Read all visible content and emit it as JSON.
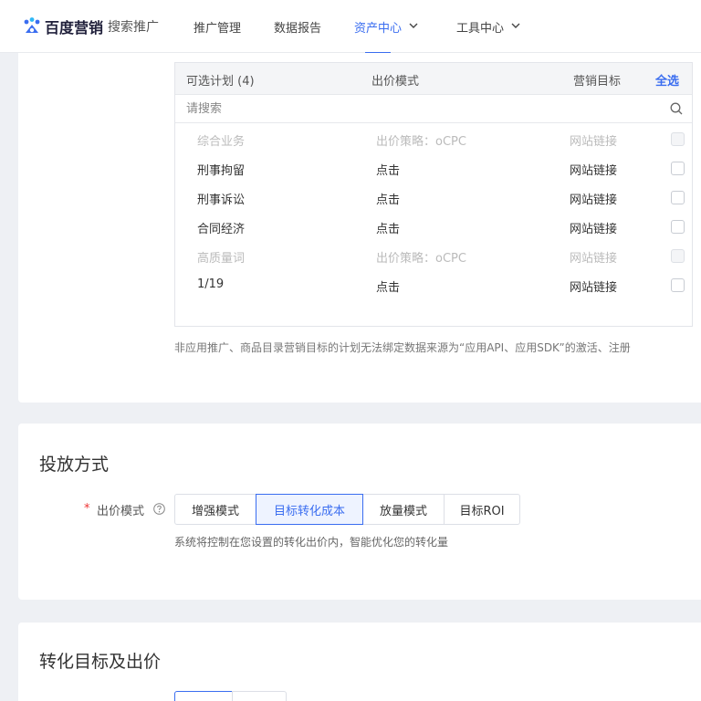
{
  "header": {
    "brand_name": "百度营销",
    "brand_sub": "搜索推广",
    "nav": [
      {
        "label": "推广管理"
      },
      {
        "label": "数据报告"
      },
      {
        "label": "资产中心"
      },
      {
        "label": "工具中心"
      }
    ]
  },
  "plan_table": {
    "col_available": "可选计划 (4)",
    "col_bid_mode": "出价模式",
    "col_goal": "营销目标",
    "select_all": "全选",
    "search_placeholder": "请搜索",
    "rows": [
      {
        "name": "综合业务",
        "bid": "出价策略：oCPC",
        "goal": "网站链接",
        "disabled": true
      },
      {
        "name": "刑事拘留",
        "bid": "点击",
        "goal": "网站链接",
        "disabled": false
      },
      {
        "name": "刑事诉讼",
        "bid": "点击",
        "goal": "网站链接",
        "disabled": false
      },
      {
        "name": "合同经济",
        "bid": "点击",
        "goal": "网站链接",
        "disabled": false
      },
      {
        "name": "高质量词",
        "bid": "出价策略：oCPC",
        "goal": "网站链接",
        "disabled": true
      },
      {
        "name": "1/19",
        "bid": "点击",
        "goal": "网站链接",
        "disabled": false
      }
    ],
    "note": "非应用推广、商品目录营销目标的计划无法绑定数据来源为“应用API、应用SDK”的激活、注册"
  },
  "delivery": {
    "title": "投放方式",
    "required_mark": "*",
    "bid_mode_label": "出价模式",
    "options": [
      "增强模式",
      "目标转化成本",
      "放量模式",
      "目标ROI"
    ],
    "selected": "目标转化成本",
    "hint": "系统将控制在您设置的转化出价内，智能优化您的转化量"
  },
  "conversion": {
    "title": "转化目标及出价",
    "partial_label": "",
    "partial_options": [
      "",
      ""
    ]
  },
  "colors": {
    "accent": "#3a6df0",
    "background": "#eef0f4",
    "required": "#e33"
  }
}
